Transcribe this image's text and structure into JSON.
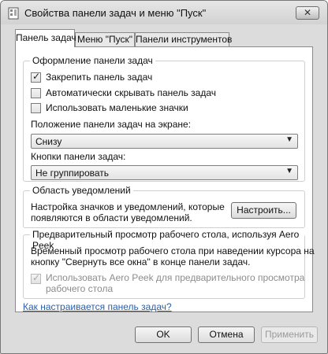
{
  "window": {
    "title": "Свойства панели задач и меню \"Пуск\"",
    "close_glyph": "✕"
  },
  "tabs": [
    {
      "label": "Панель задач",
      "active": true
    },
    {
      "label": "Меню \"Пуск\"",
      "active": false
    },
    {
      "label": "Панели инструментов",
      "active": false
    }
  ],
  "appearance": {
    "title": "Оформление панели задач",
    "checkboxes": [
      {
        "label": "Закрепить панель задач",
        "checked": true
      },
      {
        "label": "Автоматически скрывать панель задач",
        "checked": false
      },
      {
        "label": "Использовать маленькие значки",
        "checked": false
      }
    ],
    "position_label": "Положение панели задач на экране:",
    "position_value": "Снизу",
    "buttons_label": "Кнопки панели задач:",
    "buttons_value": "Не группировать"
  },
  "notifications": {
    "title": "Область уведомлений",
    "text_line1": "Настройка значков и уведомлений, которые",
    "text_line2": "появляются в области уведомлений.",
    "customize_button": "Настроить..."
  },
  "aero_peek": {
    "title": "Предварительный просмотр рабочего стола, используя Aero Peek",
    "text_line1": "Временный просмотр рабочего стола при наведении курсора на",
    "text_line2": "кнопку \"Свернуть все окна\" в конце панели задач.",
    "checkbox_line1": "Использовать Aero Peek для предварительного просмотра",
    "checkbox_line2": "рабочего стола",
    "checkbox_checked": true,
    "checkbox_enabled": false
  },
  "help_link": "Как настраивается панель задач?",
  "footer": {
    "ok": "OK",
    "cancel": "Отмена",
    "apply": "Применить"
  }
}
